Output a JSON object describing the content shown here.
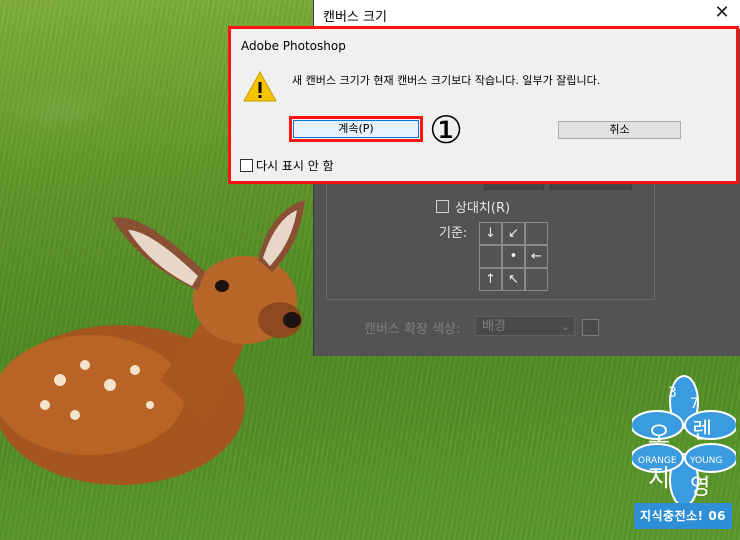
{
  "photoshop_dialog": {
    "title": "캔버스 크기",
    "relative_label": "상대치(R)",
    "anchor_label": "기준:",
    "anchor_arrows": [
      "↓",
      "↙",
      "",
      "",
      "•",
      "←",
      "↑",
      "↖",
      ""
    ],
    "extension_color_label": "캔버스 확장 색상:",
    "extension_color_value": "배경"
  },
  "alert": {
    "title": "Adobe Photoshop",
    "message": "새 캔버스 크기가 현재 캔버스 크기보다 작습니다. 일부가 잘립니다.",
    "continue_label": "계속(P)",
    "cancel_label": "취소",
    "dont_show_label": "다시 표시 안 함",
    "step_marker": "①"
  },
  "watermark": {
    "numbers": [
      "3",
      "7"
    ],
    "syllables": [
      "오",
      "렌",
      "지",
      "영"
    ],
    "words": [
      "ORANGE",
      "YOUNG"
    ],
    "badge": "지식충전소! 06"
  },
  "colors": {
    "highlight_red": "#ff1212",
    "ps_dark": "#535353",
    "watermark_blue": "#2e8ed6"
  }
}
